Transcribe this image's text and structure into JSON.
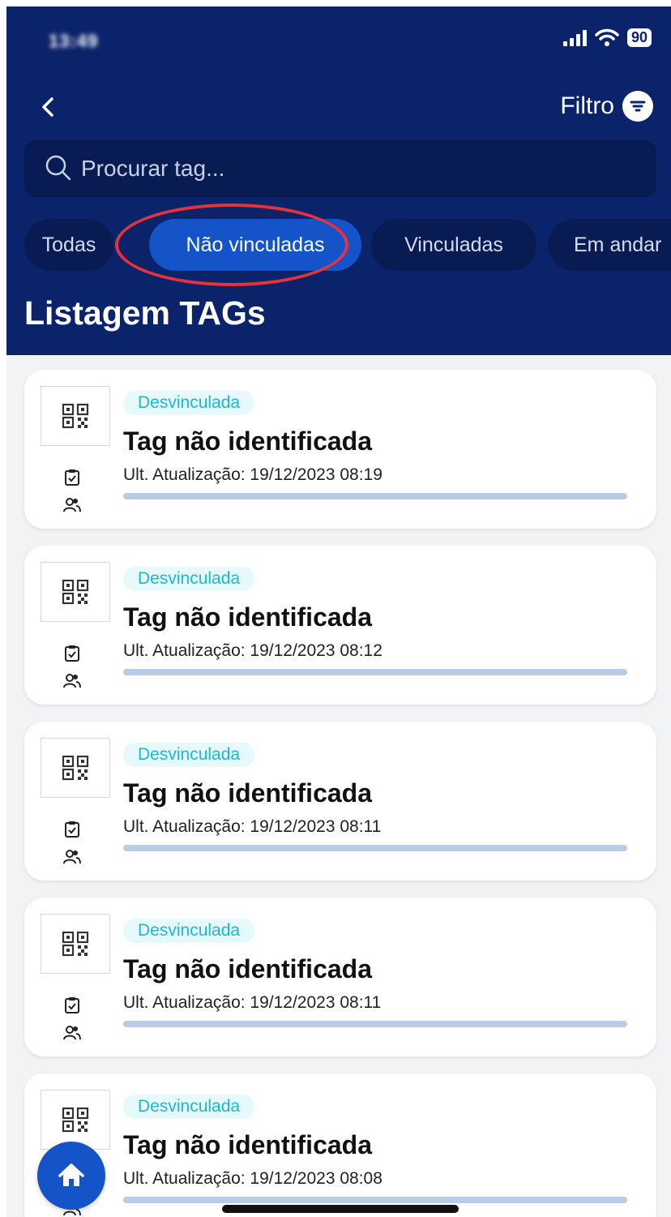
{
  "status_bar": {
    "time": "13:49",
    "battery": "90"
  },
  "header": {
    "filter_label": "Filtro"
  },
  "search": {
    "placeholder": "Procurar tag..."
  },
  "chips": [
    {
      "label": "Todas",
      "active": false
    },
    {
      "label": "Não vinculadas",
      "active": true
    },
    {
      "label": "Vinculadas",
      "active": false
    },
    {
      "label": "Em andar",
      "active": false
    }
  ],
  "title": "Listagem TAGs",
  "cards": [
    {
      "badge": "Desvinculada",
      "title": "Tag não identificada",
      "update": "Ult. Atualização: 19/12/2023 08:19"
    },
    {
      "badge": "Desvinculada",
      "title": "Tag não identificada",
      "update": "Ult. Atualização: 19/12/2023 08:12"
    },
    {
      "badge": "Desvinculada",
      "title": "Tag não identificada",
      "update": "Ult. Atualização: 19/12/2023 08:11"
    },
    {
      "badge": "Desvinculada",
      "title": "Tag não identificada",
      "update": "Ult. Atualização: 19/12/2023 08:11"
    },
    {
      "badge": "Desvinculada",
      "title": "Tag não identificada",
      "update": "Ult. Atualização: 19/12/2023 08:08"
    }
  ],
  "icons": {
    "back": "chevron-left-icon",
    "filter": "filter-icon",
    "search": "search-icon",
    "qr": "qr-code-icon",
    "clipboard": "clipboard-check-icon",
    "people": "people-icon",
    "home": "home-icon"
  },
  "colors": {
    "header_bg": "#0b236b",
    "chip_active": "#1553c9",
    "badge_text": "#1fb8cf",
    "annotation_ring": "#e5333b"
  }
}
